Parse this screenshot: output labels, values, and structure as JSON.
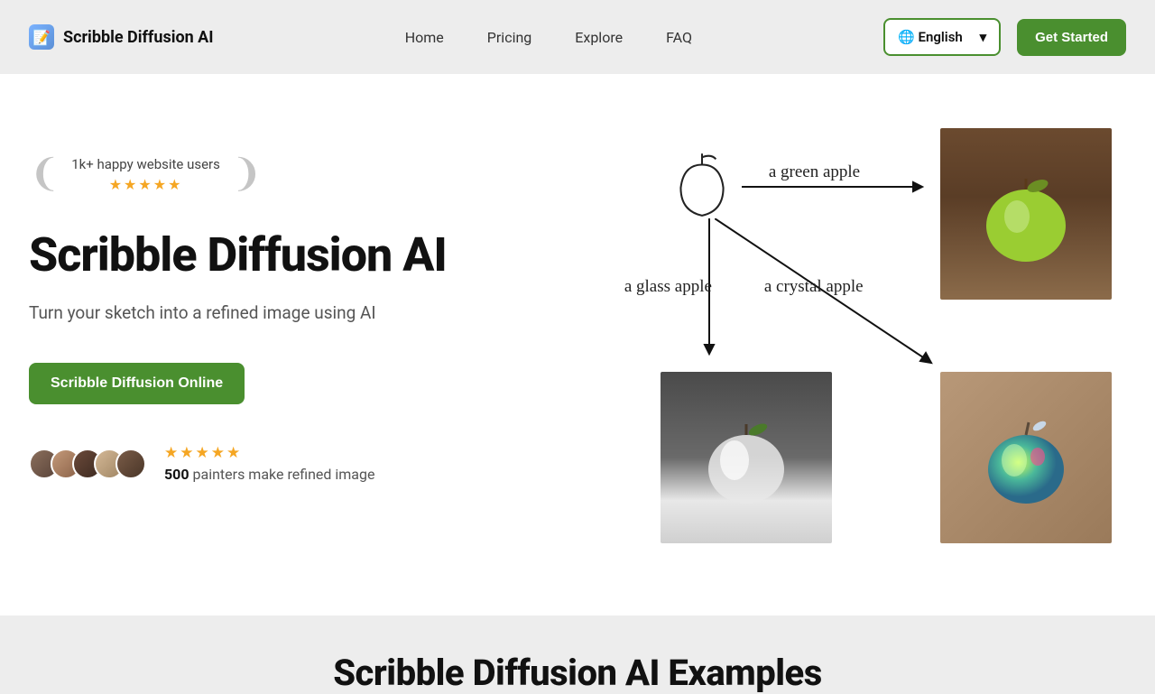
{
  "header": {
    "logo_text": "Scribble Diffusion AI",
    "nav": [
      "Home",
      "Pricing",
      "Explore",
      "FAQ"
    ],
    "language": "🌐 English",
    "get_started": "Get Started"
  },
  "hero": {
    "laurel_text": "1k+ happy website users",
    "title": "Scribble Diffusion AI",
    "subtitle": "Turn your sketch into a refined image using AI",
    "cta": "Scribble Diffusion Online",
    "social_count": "500",
    "social_rest": " painters make refined image",
    "demo_labels": {
      "green": "a green apple",
      "glass": "a glass apple",
      "crystal": "a crystal apple"
    }
  },
  "examples": {
    "title": "Scribble Diffusion AI Examples"
  },
  "colors": {
    "primary": "#4a8f2f",
    "star": "#f5a623"
  }
}
